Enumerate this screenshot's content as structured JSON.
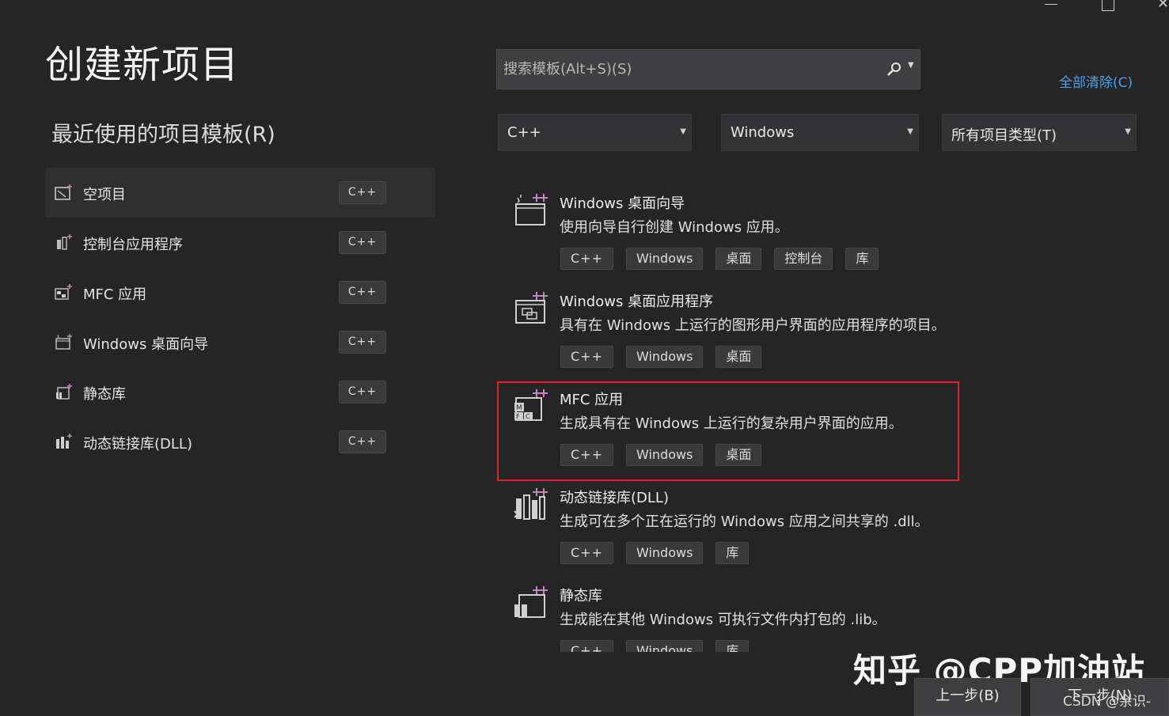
{
  "window_controls": {
    "minimize": "minimize",
    "maximize": "maximize",
    "close": "✕"
  },
  "page_title": "创建新项目",
  "recent": {
    "title": "最近使用的项目模板(R)",
    "items": [
      {
        "label": "空项目",
        "lang": "C++",
        "icon": "empty-project-icon"
      },
      {
        "label": "控制台应用程序",
        "lang": "C++",
        "icon": "console-app-icon"
      },
      {
        "label": "MFC 应用",
        "lang": "C++",
        "icon": "mfc-app-icon"
      },
      {
        "label": "Windows 桌面向导",
        "lang": "C++",
        "icon": "desktop-wizard-icon"
      },
      {
        "label": "静态库",
        "lang": "C++",
        "icon": "static-lib-icon"
      },
      {
        "label": "动态链接库(DLL)",
        "lang": "C++",
        "icon": "dll-icon"
      }
    ]
  },
  "search": {
    "placeholder": "搜索模板(Alt+S)(S)",
    "value": ""
  },
  "clear_all": "全部清除(C)",
  "filters": {
    "language": "C++",
    "platform": "Windows",
    "project_type": "所有项目类型(T)"
  },
  "templates": [
    {
      "name": "Windows 桌面向导",
      "desc": "使用向导自行创建 Windows 应用。",
      "tags": [
        "C++",
        "Windows",
        "桌面",
        "控制台",
        "库"
      ]
    },
    {
      "name": "Windows 桌面应用程序",
      "desc": "具有在 Windows 上运行的图形用户界面的应用程序的项目。",
      "tags": [
        "C++",
        "Windows",
        "桌面"
      ]
    },
    {
      "name": "MFC 应用",
      "desc": "生成具有在 Windows 上运行的复杂用户界面的应用。",
      "tags": [
        "C++",
        "Windows",
        "桌面"
      ]
    },
    {
      "name": "动态链接库(DLL)",
      "desc": "生成可在多个正在运行的 Windows 应用之间共享的 .dll。",
      "tags": [
        "C++",
        "Windows",
        "库"
      ]
    },
    {
      "name": "静态库",
      "desc": "生成能在其他 Windows 可执行文件内打包的 .lib。",
      "tags": [
        "C++",
        "Windows",
        "库"
      ]
    }
  ],
  "highlight_color": "#e0202a",
  "accent_link_color": "#4ea0e6",
  "watermark": "知乎 @CPP加油站",
  "footer": {
    "back": "上一步(B)",
    "next": "下一步(N)"
  },
  "csdn_mark": "CSDN @余识-"
}
